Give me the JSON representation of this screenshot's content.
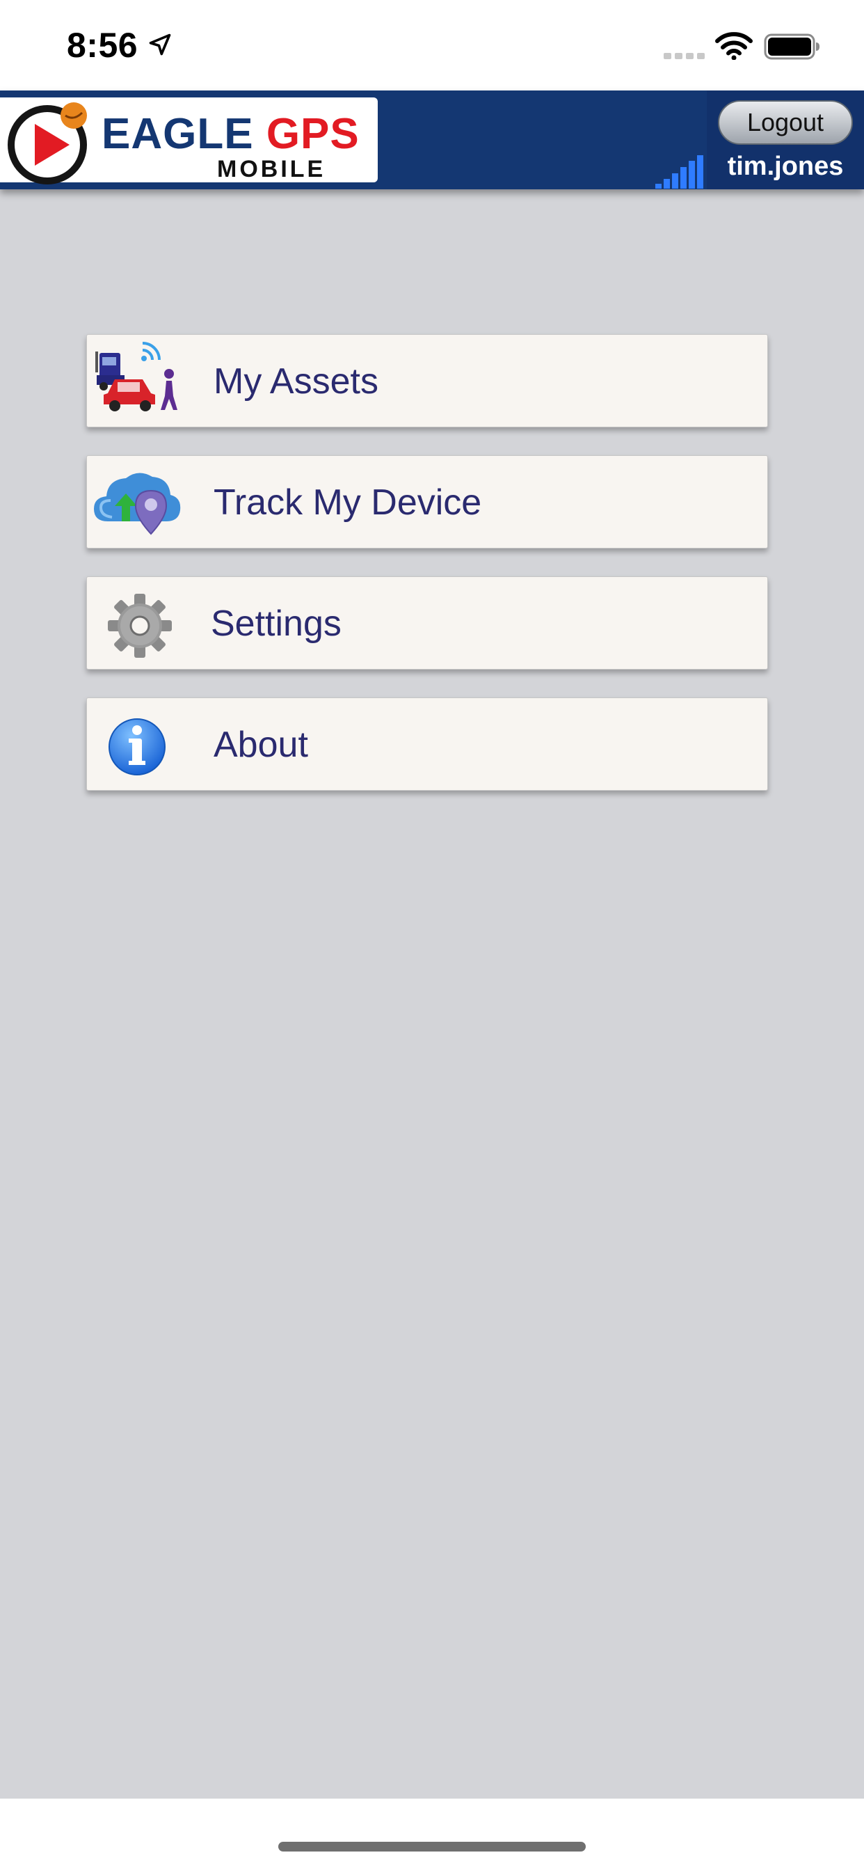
{
  "status_bar": {
    "time": "8:56",
    "icons": [
      "location-arrow-icon",
      "cellular-signal-icon",
      "wifi-icon",
      "battery-icon"
    ]
  },
  "header": {
    "logo": {
      "word_eagle": "EAGLE",
      "word_gps": "GPS",
      "word_mobile": "MOBILE"
    },
    "logout_label": "Logout",
    "username": "tim.jones",
    "colors": {
      "header_bg": "#143772",
      "logo_red": "#e21b23",
      "signal_blue": "#2f7cff"
    }
  },
  "menu": {
    "items": [
      {
        "label": "My Assets",
        "icon": "assets-vehicles-icon"
      },
      {
        "label": "Track My Device",
        "icon": "cloud-upload-location-icon"
      },
      {
        "label": "Settings",
        "icon": "gear-icon"
      },
      {
        "label": "About",
        "icon": "info-icon"
      }
    ],
    "colors": {
      "item_bg": "#f8f5f1",
      "item_text": "#2a2a6f",
      "page_bg": "#d3d4d8"
    }
  }
}
